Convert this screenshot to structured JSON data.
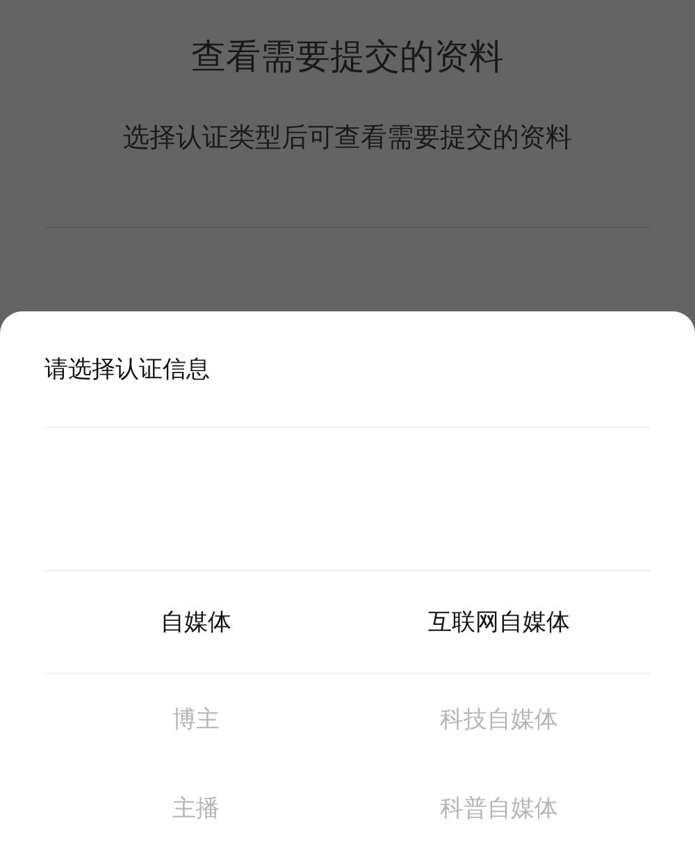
{
  "page": {
    "title": "查看需要提交的资料",
    "subtitle": "选择认证类型后可查看需要提交的资料"
  },
  "sheet": {
    "title": "请选择认证信息",
    "columns": [
      {
        "items": [
          {
            "label": "自媒体",
            "selected": true
          },
          {
            "label": "博主",
            "selected": false
          },
          {
            "label": "主播",
            "selected": false
          }
        ]
      },
      {
        "items": [
          {
            "label": "互联网自媒体",
            "selected": true
          },
          {
            "label": "科技自媒体",
            "selected": false
          },
          {
            "label": "科普自媒体",
            "selected": false
          }
        ]
      }
    ]
  }
}
